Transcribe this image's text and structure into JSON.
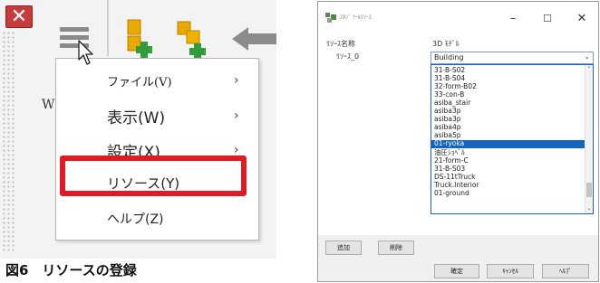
{
  "left_panel": {
    "background_letter": "W",
    "close_glyph": "✕",
    "menu": {
      "items": [
        {
          "label": "ファイル(V)",
          "has_submenu": true,
          "submenu_glyph": "›"
        },
        {
          "label": "表示(W)",
          "has_submenu": true,
          "submenu_glyph": "›"
        },
        {
          "label": "設定(X)",
          "has_submenu": true,
          "submenu_glyph": "›"
        },
        {
          "label": "リソース(Y)",
          "has_submenu": false,
          "highlighted": true
        },
        {
          "label": "ヘルプ(Z)",
          "has_submenu": false
        }
      ]
    },
    "highlight_color": "#e01b24",
    "icons": [
      "menu-hamburger-icon",
      "add-resource-icon",
      "add-resource-alt-icon",
      "back-arrow-icon"
    ]
  },
  "caption": "図6　リソースの登録",
  "dialog": {
    "title": "ｽﾀｼﾞ ﾂｰﾙﾘｿｰｽ",
    "window_buttons": {
      "minimize": "–",
      "maximize": "☐",
      "close": "✕"
    },
    "column_resource_name": "ﾘｿｰｽ名称",
    "column_3d_model": "3D ﾓﾃﾞﾙ",
    "resource_row": "ﾘｿｰｽ_0",
    "combo": {
      "value": "Building",
      "dropdown_glyph": "⌄"
    },
    "list_items": [
      "31-B-S02",
      "31-B-S04",
      "32-form-B02",
      "33-con-B",
      "asiba_stair",
      "asiba3p",
      "asiba3p",
      "asiba4p",
      "asiba5p",
      "01-ryoka",
      "油圧ｼｮﾍﾞﾙ",
      "21-form-C",
      "31-B-S03",
      "DS-11tTruck",
      "Truck.Interior",
      "01-ground"
    ],
    "selected_index": 9,
    "scroll_up_glyph": "⌃",
    "scroll_down_glyph": "⌄",
    "buttons": {
      "add": "追加",
      "delete": "削除",
      "ok": "確定",
      "cancel": "ｷｬﾝｾﾙ",
      "help": "ﾍﾙﾌﾟ"
    },
    "accent": "#1565c0"
  }
}
